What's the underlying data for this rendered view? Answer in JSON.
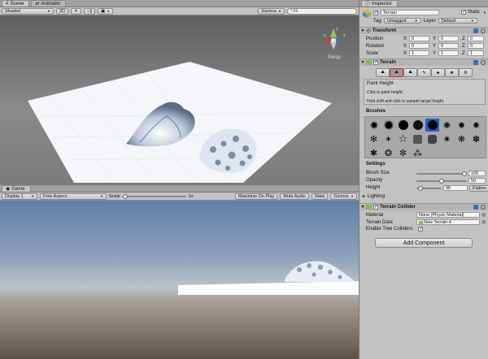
{
  "scene": {
    "tabs": [
      {
        "label": "Scene"
      },
      {
        "label": "Animator"
      }
    ],
    "shading": "Shaded",
    "mode_2d": "2D",
    "gizmos": "Gizmos",
    "search_placeholder": "All",
    "persp_label": "Persp",
    "axis_y": "y",
    "axis_x": "x",
    "axis_z": "z"
  },
  "game": {
    "tab": "Game",
    "display": "Display 1",
    "aspect": "Free Aspect",
    "scale_label": "Scale",
    "scale_value": "1x",
    "scale_level": 0.0,
    "maximize": "Maximize On Play",
    "mute": "Mute Audio",
    "stats": "Stats",
    "gizmos": "Gizmos"
  },
  "inspector": {
    "tab": "Inspector",
    "object_name": "Terrain",
    "static_label": "Static",
    "tag_label": "Tag",
    "tag_value": "Untagged",
    "layer_label": "Layer",
    "layer_value": "Default",
    "transform": {
      "title": "Transform",
      "rows": [
        {
          "label": "Position",
          "x": "0",
          "y": "0",
          "z": "0"
        },
        {
          "label": "Rotation",
          "x": "0",
          "y": "0",
          "z": "0"
        },
        {
          "label": "Scale",
          "x": "1",
          "y": "1",
          "z": "1"
        }
      ],
      "axis_x": "X",
      "axis_y": "Y",
      "axis_z": "Z"
    },
    "terrain": {
      "title": "Terrain",
      "tool_title": "Paint Height",
      "tool_line1": "Click to paint height.",
      "tool_line2": "Hold shift and click to sample target height.",
      "brushes_label": "Brushes",
      "settings_label": "Settings",
      "brush_size_label": "Brush Size",
      "brush_size_value": "100",
      "brush_size_level": 1.0,
      "opacity_label": "Opacity",
      "opacity_value": "50",
      "opacity_level": 0.5,
      "height_label": "Height",
      "height_value": "96",
      "height_level": 0.1,
      "flatten_label": "Flatten",
      "lighting_label": "Lighting"
    },
    "collider": {
      "title": "Terrain Collider",
      "material_label": "Material",
      "material_value": "None (Physic Material)",
      "data_label": "Terrain Data",
      "data_value": "New Terrain 4",
      "trees_label": "Enable Tree Colliders"
    },
    "add_component": "Add Component"
  }
}
